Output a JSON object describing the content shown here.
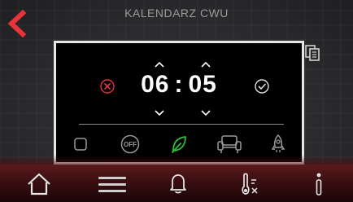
{
  "header": {
    "title": "KALENDARZ CWU"
  },
  "modal": {
    "time": {
      "hours": "06",
      "separator": ":",
      "minutes": "05"
    },
    "modes": [
      {
        "name": "empty",
        "icon": "checkbox-icon",
        "selected": false
      },
      {
        "name": "off",
        "label": "OFF",
        "icon": "off-icon",
        "selected": false
      },
      {
        "name": "eco",
        "icon": "leaf-icon",
        "selected": true
      },
      {
        "name": "comfort",
        "icon": "armchair-icon",
        "selected": false
      },
      {
        "name": "boost",
        "icon": "rocket-icon",
        "selected": false
      }
    ]
  },
  "colors": {
    "accent": "#e8333a",
    "eco_green": "#2fbf3a",
    "bar_red": "#5a1a1c"
  },
  "bottom_nav": [
    {
      "icon": "home-icon"
    },
    {
      "icon": "menu-icon"
    },
    {
      "icon": "bell-icon"
    },
    {
      "icon": "thermometer-icon"
    },
    {
      "icon": "info-icon"
    }
  ]
}
